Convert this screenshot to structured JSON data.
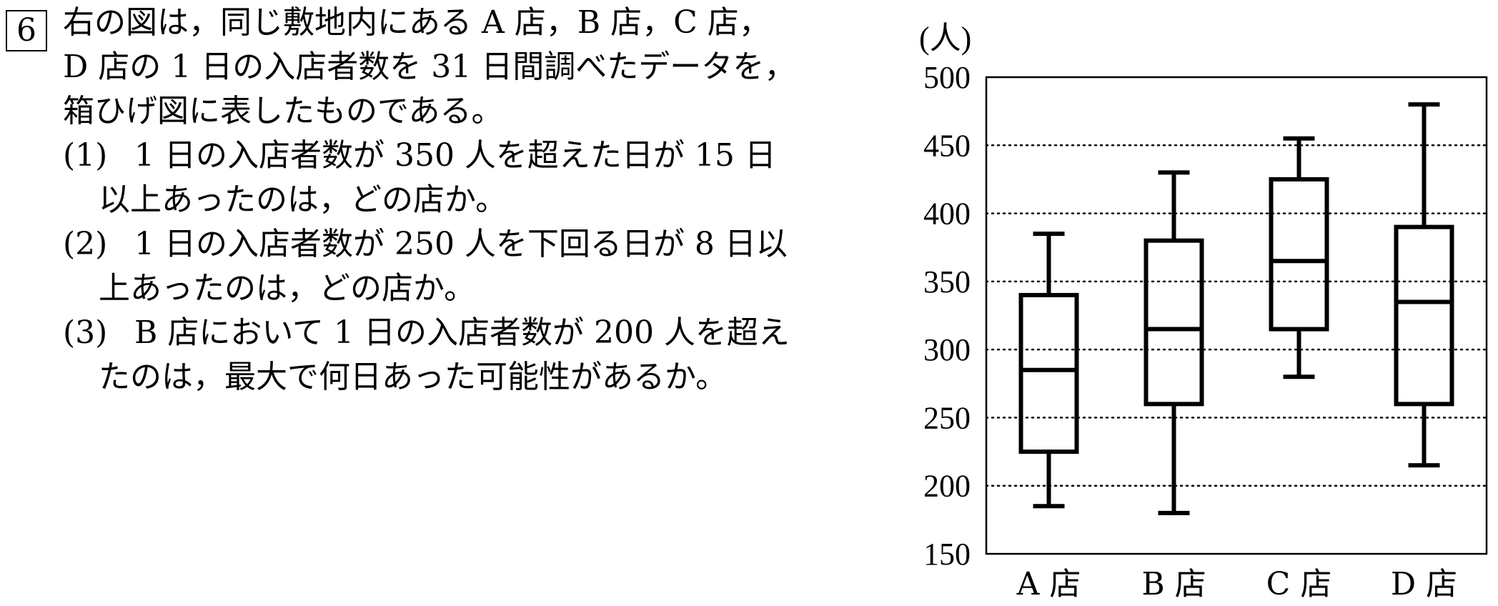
{
  "problem": {
    "number": "6",
    "intro_lines": [
      "右の図は，同じ敷地内にある A 店，B 店，C 店，",
      "D 店の 1 日の入店者数を 31 日間調べたデータを，",
      "箱ひげ図に表したものである。"
    ],
    "questions": [
      {
        "mark": "(1)",
        "lines": [
          "1 日の入店者数が 350 人を超えた日が 15 日",
          "以上あったのは，どの店か。"
        ]
      },
      {
        "mark": "(2)",
        "lines": [
          "1 日の入店者数が 250 人を下回る日が 8 日以",
          "上あったのは，どの店か。"
        ]
      },
      {
        "mark": "(3)",
        "lines": [
          "B 店において 1 日の入店者数が 200 人を超え",
          "たのは，最大で何日あった可能性があるか。"
        ]
      }
    ]
  },
  "chart_data": {
    "type": "boxplot",
    "unit_label": "(人)",
    "ylim": [
      150,
      500
    ],
    "yticks": [
      150,
      200,
      250,
      300,
      350,
      400,
      450,
      500
    ],
    "grid": "dotted horizontal",
    "categories": [
      "A 店",
      "B 店",
      "C 店",
      "D 店"
    ],
    "boxes": [
      {
        "category": "A 店",
        "min": 185,
        "q1": 225,
        "median": 285,
        "q3": 340,
        "max": 385
      },
      {
        "category": "B 店",
        "min": 180,
        "q1": 260,
        "median": 315,
        "q3": 380,
        "max": 430
      },
      {
        "category": "C 店",
        "min": 280,
        "q1": 315,
        "median": 365,
        "q3": 425,
        "max": 455
      },
      {
        "category": "D 店",
        "min": 215,
        "q1": 260,
        "median": 335,
        "q3": 390,
        "max": 480
      }
    ],
    "colors": {
      "stroke": "#000000",
      "grid": "#000000",
      "background": "#ffffff"
    }
  }
}
